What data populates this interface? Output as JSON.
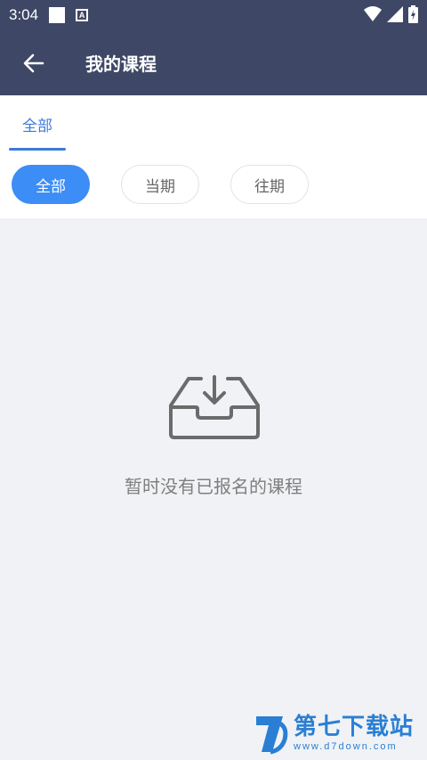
{
  "status_bar": {
    "time": "3:04"
  },
  "header": {
    "title": "我的课程"
  },
  "tabs": [
    {
      "label": "全部"
    }
  ],
  "filters": [
    {
      "label": "全部",
      "active": true
    },
    {
      "label": "当期",
      "active": false
    },
    {
      "label": "往期",
      "active": false
    }
  ],
  "empty_state": {
    "message": "暂时没有已报名的课程"
  },
  "watermark": {
    "title": "第七下载站",
    "url": "www.d7down.com"
  },
  "colors": {
    "header_bg": "#3e4766",
    "accent": "#3c8df5",
    "tab_active": "#3d7ad8",
    "page_bg": "#f0f2f5"
  }
}
